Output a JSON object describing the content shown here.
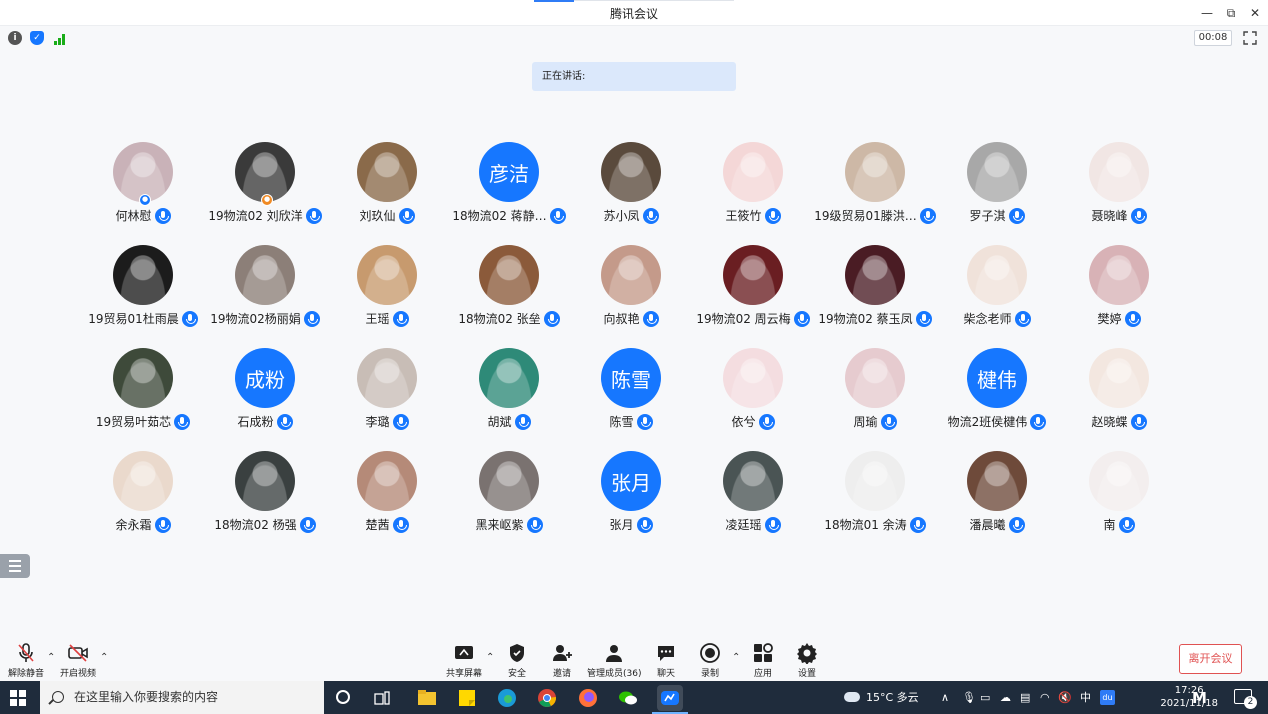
{
  "window": {
    "title": "腾讯会议",
    "minimize": "—",
    "restore": "⧉",
    "close": "✕"
  },
  "infobar": {
    "timer": "00:08",
    "icons": [
      "info-icon",
      "shield-icon",
      "signal-icon"
    ]
  },
  "speaking": {
    "label": "正在讲话:"
  },
  "participants": [
    {
      "name": "何林慰",
      "avatar_type": "photo",
      "avatar_text": "",
      "color": "#c9b2b8",
      "badge": "host"
    },
    {
      "name": "19物流02 刘欣洋",
      "avatar_type": "photo",
      "avatar_text": "",
      "color": "#3a3a3a",
      "badge": "cohost"
    },
    {
      "name": "刘玖仙",
      "avatar_type": "photo",
      "avatar_text": "",
      "color": "#8a6a4a",
      "badge": ""
    },
    {
      "name": "18物流02 蒋静…",
      "avatar_type": "text",
      "avatar_text": "彦洁",
      "color": "#1677ff",
      "badge": ""
    },
    {
      "name": "苏小凤",
      "avatar_type": "photo",
      "avatar_text": "",
      "color": "#5a4a3c",
      "badge": ""
    },
    {
      "name": "王筱竹",
      "avatar_type": "photo",
      "avatar_text": "",
      "color": "#f4d7d7",
      "badge": ""
    },
    {
      "name": "19级贸易01滕洪…",
      "avatar_type": "photo",
      "avatar_text": "",
      "color": "#cdb8a6",
      "badge": ""
    },
    {
      "name": "罗子淇",
      "avatar_type": "photo",
      "avatar_text": "",
      "color": "#a8a8a8",
      "badge": ""
    },
    {
      "name": "聂晓峰",
      "avatar_type": "photo",
      "avatar_text": "",
      "color": "#f1e6e4",
      "badge": ""
    },
    {
      "name": "19贸易01杜雨晨",
      "avatar_type": "photo",
      "avatar_text": "",
      "color": "#1c1c1c",
      "badge": ""
    },
    {
      "name": "19物流02杨丽娟",
      "avatar_type": "photo",
      "avatar_text": "",
      "color": "#8c7f78",
      "badge": ""
    },
    {
      "name": "王瑶",
      "avatar_type": "photo",
      "avatar_text": "",
      "color": "#c79a6e",
      "badge": ""
    },
    {
      "name": "18物流02 张垒",
      "avatar_type": "photo",
      "avatar_text": "",
      "color": "#8b5a3a",
      "badge": ""
    },
    {
      "name": "向叔艳",
      "avatar_type": "photo",
      "avatar_text": "",
      "color": "#c49a8a",
      "badge": ""
    },
    {
      "name": "19物流02 周云梅",
      "avatar_type": "photo",
      "avatar_text": "",
      "color": "#6a1e22",
      "badge": ""
    },
    {
      "name": "19物流02 蔡玉凤",
      "avatar_type": "photo",
      "avatar_text": "",
      "color": "#4a1c24",
      "badge": ""
    },
    {
      "name": "柴念老师",
      "avatar_type": "photo",
      "avatar_text": "",
      "color": "#f0e2da",
      "badge": ""
    },
    {
      "name": "樊婷",
      "avatar_type": "photo",
      "avatar_text": "",
      "color": "#d8b2b6",
      "badge": ""
    },
    {
      "name": "19贸易叶茹芯",
      "avatar_type": "photo",
      "avatar_text": "",
      "color": "#3e4a3a",
      "badge": ""
    },
    {
      "name": "石成粉",
      "avatar_type": "text",
      "avatar_text": "成粉",
      "color": "#1677ff",
      "badge": ""
    },
    {
      "name": "李璐",
      "avatar_type": "photo",
      "avatar_text": "",
      "color": "#c8bdb6",
      "badge": ""
    },
    {
      "name": "胡斌",
      "avatar_type": "photo",
      "avatar_text": "",
      "color": "#2e8a78",
      "badge": ""
    },
    {
      "name": "陈雪",
      "avatar_type": "text",
      "avatar_text": "陈雪",
      "color": "#1677ff",
      "badge": ""
    },
    {
      "name": "依兮",
      "avatar_type": "photo",
      "avatar_text": "",
      "color": "#f4dde0",
      "badge": ""
    },
    {
      "name": "周瑜",
      "avatar_type": "photo",
      "avatar_text": "",
      "color": "#e6cbcf",
      "badge": ""
    },
    {
      "name": "物流2班侯楗伟",
      "avatar_type": "text",
      "avatar_text": "楗伟",
      "color": "#1677ff",
      "badge": ""
    },
    {
      "name": "赵晓蝶",
      "avatar_type": "photo",
      "avatar_text": "",
      "color": "#f3e7e0",
      "badge": ""
    },
    {
      "name": "余永霜",
      "avatar_type": "photo",
      "avatar_text": "",
      "color": "#ead9cc",
      "badge": ""
    },
    {
      "name": "18物流02 杨强",
      "avatar_type": "photo",
      "avatar_text": "",
      "color": "#3a4040",
      "badge": ""
    },
    {
      "name": "楚茜",
      "avatar_type": "photo",
      "avatar_text": "",
      "color": "#b58a78",
      "badge": ""
    },
    {
      "name": "黑来岖紫",
      "avatar_type": "photo",
      "avatar_text": "",
      "color": "#7a7270",
      "badge": ""
    },
    {
      "name": "张月",
      "avatar_type": "text",
      "avatar_text": "张月",
      "color": "#1677ff",
      "badge": ""
    },
    {
      "name": "凌廷瑶",
      "avatar_type": "photo",
      "avatar_text": "",
      "color": "#4a5454",
      "badge": ""
    },
    {
      "name": "18物流01  余涛",
      "avatar_type": "photo",
      "avatar_text": "",
      "color": "#eeeeee",
      "badge": ""
    },
    {
      "name": "潘晨曦",
      "avatar_type": "photo",
      "avatar_text": "",
      "color": "#6e4a3a",
      "badge": ""
    },
    {
      "name": "南",
      "avatar_type": "photo",
      "avatar_text": "",
      "color": "#f3eeee",
      "badge": ""
    }
  ],
  "toolbar": {
    "unmute": "解除静音",
    "start_video": "开启视频",
    "share_screen": "共享屏幕",
    "security": "安全",
    "invite": "邀请",
    "manage_members": "管理成员(36)",
    "chat": "聊天",
    "record": "录制",
    "apps": "应用",
    "settings": "设置",
    "leave": "离开会议"
  },
  "taskbar": {
    "search_placeholder": "在这里输入你要搜索的内容",
    "weather": "15°C  多云",
    "ime": "中",
    "time": "17:26",
    "date": "2021/11/18",
    "notifications": "2"
  }
}
